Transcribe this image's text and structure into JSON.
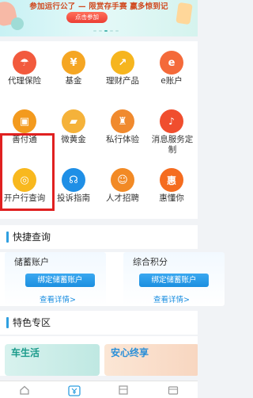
{
  "banner": {
    "headline": "参加运行公了 — 限赏存手赛 赢多惊到记",
    "button_label": "点击参加"
  },
  "grid": {
    "items": [
      {
        "label": "代理保险",
        "icon": "umbrella-icon",
        "color": "#f25a3d",
        "glyph": "☂"
      },
      {
        "label": "基金",
        "icon": "coin-bag-icon",
        "color": "#f5a623",
        "glyph": "¥"
      },
      {
        "label": "理财产品",
        "icon": "chart-up-icon",
        "color": "#f6b51e",
        "glyph": "↗"
      },
      {
        "label": "e账户",
        "icon": "e-account-icon",
        "color": "#f46a3a",
        "glyph": "e"
      },
      {
        "label": "善付通",
        "icon": "payment-card-icon",
        "color": "#f39a1e",
        "glyph": "▣"
      },
      {
        "label": "微黄金",
        "icon": "gold-bar-icon",
        "color": "#f5b23a",
        "glyph": "▰"
      },
      {
        "label": "私行体验",
        "icon": "private-bank-icon",
        "color": "#f08a2e",
        "glyph": "♜"
      },
      {
        "label": "消息服务定制",
        "icon": "bell-icon",
        "color": "#f04e2e",
        "glyph": "🔔"
      },
      {
        "label": "开户行查询",
        "icon": "bank-search-icon",
        "color": "#f8b81e",
        "glyph": "◎"
      },
      {
        "label": "投诉指南",
        "icon": "headset-icon",
        "color": "#1f8fe6",
        "glyph": "☊"
      },
      {
        "label": "人才招聘",
        "icon": "person-icon",
        "color": "#f28a25",
        "glyph": "☺"
      },
      {
        "label": "惠懂你",
        "icon": "hui-icon",
        "color": "#f56c1f",
        "glyph": "惠"
      }
    ]
  },
  "quick_query": {
    "title": "快捷查询",
    "cards": [
      {
        "title": "储蓄账户",
        "button": "绑定储蓄账户",
        "link": "查看详情>"
      },
      {
        "title": "综合积分",
        "button": "绑定储蓄账户",
        "link": "查看详情>"
      }
    ]
  },
  "features": {
    "title": "特色专区",
    "cards": [
      {
        "text": "车生活"
      },
      {
        "text": "安心终享"
      }
    ]
  },
  "bottom_nav": {
    "items": [
      {
        "icon": "home-icon"
      },
      {
        "icon": "finance-yen-icon"
      },
      {
        "icon": "grid-apps-icon"
      },
      {
        "icon": "wallet-icon"
      }
    ]
  }
}
